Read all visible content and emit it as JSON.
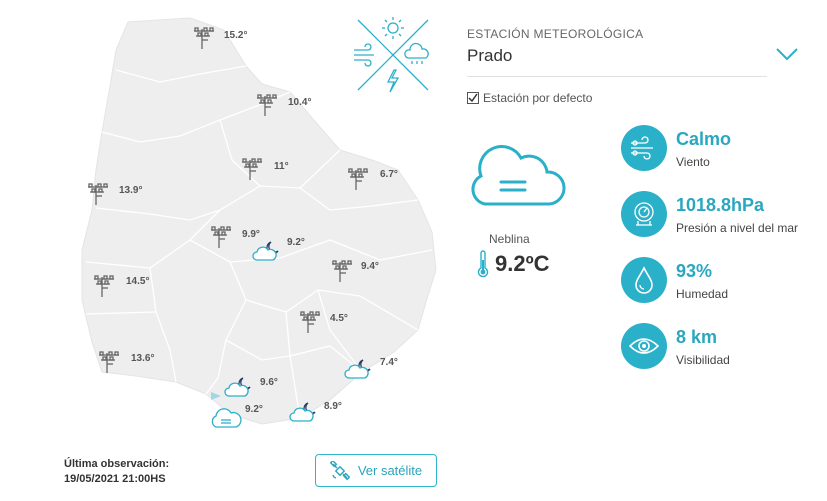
{
  "map": {
    "stations": [
      {
        "name": "station-1",
        "temp": "15.2°",
        "type": "tower"
      },
      {
        "name": "station-2",
        "temp": "10.4°",
        "type": "tower"
      },
      {
        "name": "station-3",
        "temp": "11°",
        "type": "tower"
      },
      {
        "name": "station-4",
        "temp": "6.7°",
        "type": "tower"
      },
      {
        "name": "station-5",
        "temp": "13.9°",
        "type": "tower"
      },
      {
        "name": "station-6",
        "temp": "9.9°",
        "type": "tower"
      },
      {
        "name": "station-7",
        "temp": "9.2°",
        "type": "night-cloud"
      },
      {
        "name": "station-8",
        "temp": "9.4°",
        "type": "tower"
      },
      {
        "name": "station-9",
        "temp": "14.5°",
        "type": "tower"
      },
      {
        "name": "station-10",
        "temp": "4.5°",
        "type": "tower"
      },
      {
        "name": "station-11",
        "temp": "13.6°",
        "type": "tower"
      },
      {
        "name": "station-12",
        "temp": "7.4°",
        "type": "night-cloud"
      },
      {
        "name": "station-13",
        "temp": "9.6°",
        "type": "night-cloud"
      },
      {
        "name": "station-14",
        "temp": "9.2°",
        "type": "fog"
      },
      {
        "name": "station-15",
        "temp": "8.9°",
        "type": "night-cloud"
      }
    ]
  },
  "footer": {
    "last_obs_label": "Última observación:",
    "last_obs_value": "19/05/2021 21:00HS",
    "satellite_button": "Ver satélite"
  },
  "panel": {
    "station_label": "ESTACIÓN METEOROLÓGICA",
    "station_name": "Prado",
    "default_label": "Estación por defecto",
    "default_checked": true,
    "condition": "Neblina",
    "temperature": "9.2ºC",
    "metrics": [
      {
        "value": "Calmo",
        "label": "Viento",
        "icon": "wind-icon"
      },
      {
        "value": "1018.8hPa",
        "label": "Presión a nivel del mar",
        "icon": "barometer-icon"
      },
      {
        "value": "93%",
        "label": "Humedad",
        "icon": "drop-icon"
      },
      {
        "value": "8 km",
        "label": "Visibilidad",
        "icon": "eye-icon"
      }
    ]
  },
  "colors": {
    "accent": "#2bb0c9",
    "map_fill": "#eeeeee",
    "map_border": "#ffffff"
  }
}
